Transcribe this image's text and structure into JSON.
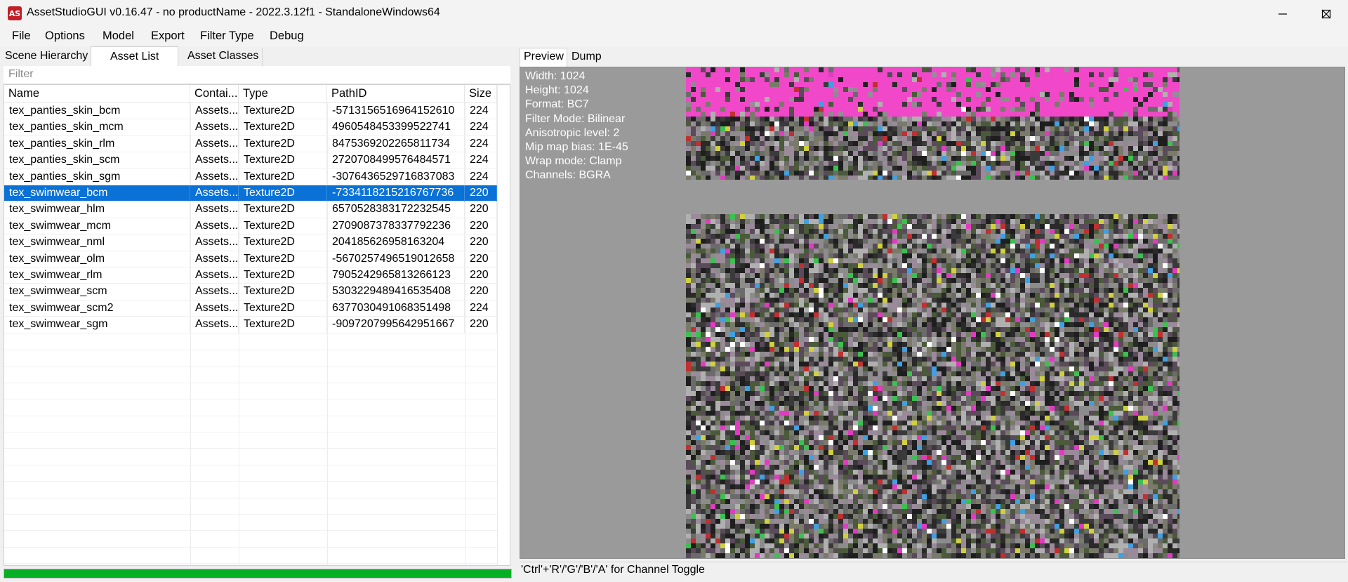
{
  "window": {
    "title": "AssetStudioGUI v0.16.47 - no productName - 2022.3.12f1 - StandaloneWindows64",
    "icon_name": "asset-studio-app-icon",
    "icon_label": "AS"
  },
  "menu": [
    "File",
    "Options",
    "Model",
    "Export",
    "Filter Type",
    "Debug"
  ],
  "left_tabs": [
    "Scene Hierarchy",
    "Asset List",
    "Asset Classes"
  ],
  "filter": {
    "placeholder": "Filter",
    "value": ""
  },
  "columns": [
    "Name",
    "Contai...",
    "Type",
    "PathID",
    "Size"
  ],
  "assets": [
    {
      "name": "tex_panties_skin_bcm",
      "container": "Assets...",
      "type": "Texture2D",
      "path_id": "-5713156516964152610",
      "size": "224"
    },
    {
      "name": "tex_panties_skin_mcm",
      "container": "Assets...",
      "type": "Texture2D",
      "path_id": "4960548453399522741",
      "size": "224"
    },
    {
      "name": "tex_panties_skin_rlm",
      "container": "Assets...",
      "type": "Texture2D",
      "path_id": "8475369202265811734",
      "size": "224"
    },
    {
      "name": "tex_panties_skin_scm",
      "container": "Assets...",
      "type": "Texture2D",
      "path_id": "2720708499576484571",
      "size": "224"
    },
    {
      "name": "tex_panties_skin_sgm",
      "container": "Assets...",
      "type": "Texture2D",
      "path_id": "-3076436529716837083",
      "size": "224"
    },
    {
      "name": "tex_swimwear_bcm",
      "container": "Assets...",
      "type": "Texture2D",
      "path_id": "-7334118215216767736",
      "size": "220",
      "selected": true
    },
    {
      "name": "tex_swimwear_hlm",
      "container": "Assets...",
      "type": "Texture2D",
      "path_id": "6570528383172232545",
      "size": "220"
    },
    {
      "name": "tex_swimwear_mcm",
      "container": "Assets...",
      "type": "Texture2D",
      "path_id": "2709087378337792236",
      "size": "220"
    },
    {
      "name": "tex_swimwear_nml",
      "container": "Assets...",
      "type": "Texture2D",
      "path_id": "204185626958163204",
      "size": "220"
    },
    {
      "name": "tex_swimwear_olm",
      "container": "Assets...",
      "type": "Texture2D",
      "path_id": "-5670257496519012658",
      "size": "220"
    },
    {
      "name": "tex_swimwear_rlm",
      "container": "Assets...",
      "type": "Texture2D",
      "path_id": "7905242965813266123",
      "size": "220"
    },
    {
      "name": "tex_swimwear_scm",
      "container": "Assets...",
      "type": "Texture2D",
      "path_id": "5303229489416535408",
      "size": "220"
    },
    {
      "name": "tex_swimwear_scm2",
      "container": "Assets...",
      "type": "Texture2D",
      "path_id": "6377030491068351498",
      "size": "224"
    },
    {
      "name": "tex_swimwear_sgm",
      "container": "Assets...",
      "type": "Texture2D",
      "path_id": "-9097207995642951667",
      "size": "220"
    }
  ],
  "progress": {
    "fraction": 1.0,
    "color": "#06b025"
  },
  "right_tabs": [
    "Preview",
    "Dump"
  ],
  "texture_info": [
    "Width: 1024",
    "Height: 1024",
    "Format: BC7",
    "Filter Mode: Bilinear",
    "Anisotropic level: 2",
    "Mip map bias: 1E-45",
    "Wrap mode: Clamp",
    "Channels: BGRA"
  ],
  "status_text": "'Ctrl'+'R'/'G'/'B'/'A' for Channel Toggle",
  "colors": {
    "selection": "#0a71d6",
    "preview_background": "#9a9a9a",
    "texture_pink": "#f048c8"
  }
}
